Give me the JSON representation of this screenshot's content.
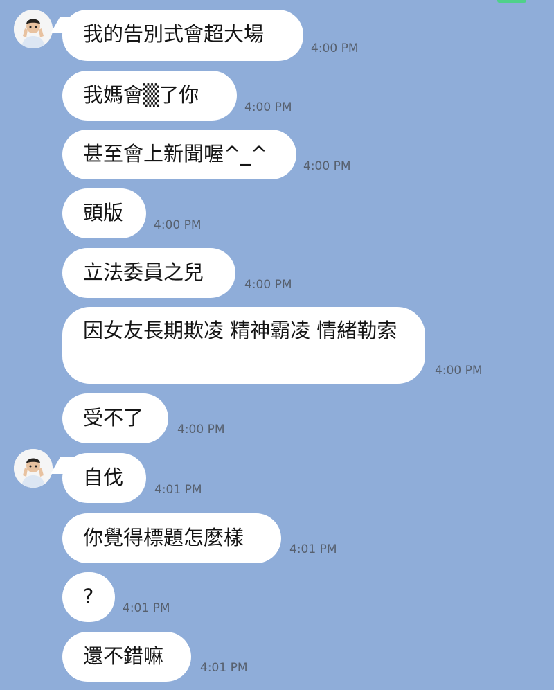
{
  "messages": [
    {
      "text": "我的告別式會超大場",
      "time": "4:00 PM"
    },
    {
      "text": "我媽會▒了你",
      "time": "4:00 PM"
    },
    {
      "text": "甚至會上新聞喔^_^",
      "time": "4:00 PM"
    },
    {
      "text": "頭版",
      "time": "4:00 PM"
    },
    {
      "text": "立法委員之兒",
      "time": "4:00 PM"
    },
    {
      "text": "因女友長期欺凌 精神霸凌 情緒勒索",
      "time": "4:00 PM"
    },
    {
      "text": "受不了",
      "time": "4:00 PM"
    },
    {
      "text": "自伐",
      "time": "4:01 PM"
    },
    {
      "text": "你覺得標題怎麼樣",
      "time": "4:01 PM"
    },
    {
      "text": "?",
      "time": "4:01 PM"
    },
    {
      "text": "還不錯嘛",
      "time": "4:01 PM"
    }
  ],
  "icons": {
    "avatar": "user-avatar-icon"
  },
  "colors": {
    "background": "#8fadd9",
    "bubble": "#ffffff",
    "timestamp": "#57606e"
  }
}
